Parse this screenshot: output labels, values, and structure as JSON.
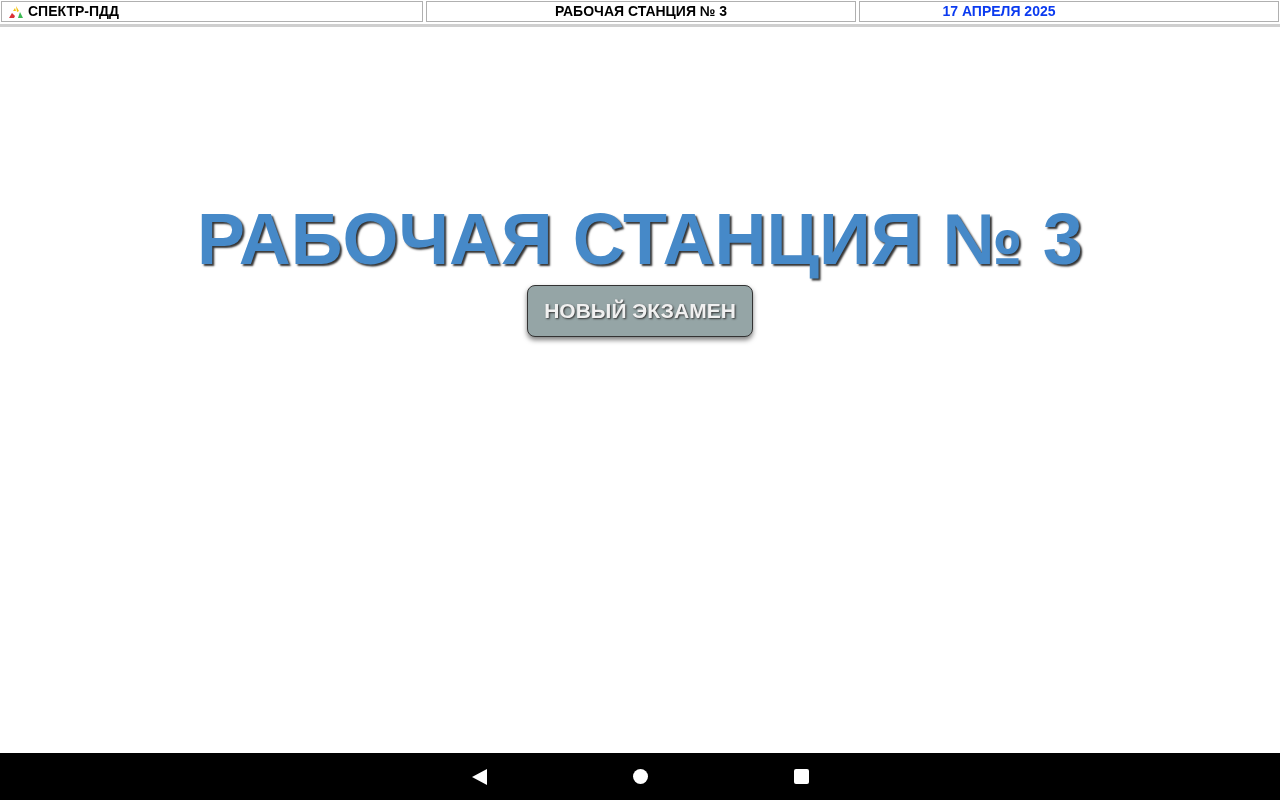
{
  "header": {
    "app_name": "СПЕКТР-ПДД",
    "station": "РАБОЧАЯ СТАНЦИЯ № 3",
    "date": "17 АПРЕЛЯ 2025"
  },
  "main": {
    "title": "РАБОЧАЯ СТАНЦИЯ № 3",
    "button": "НОВЫЙ ЭКЗАМЕН"
  }
}
